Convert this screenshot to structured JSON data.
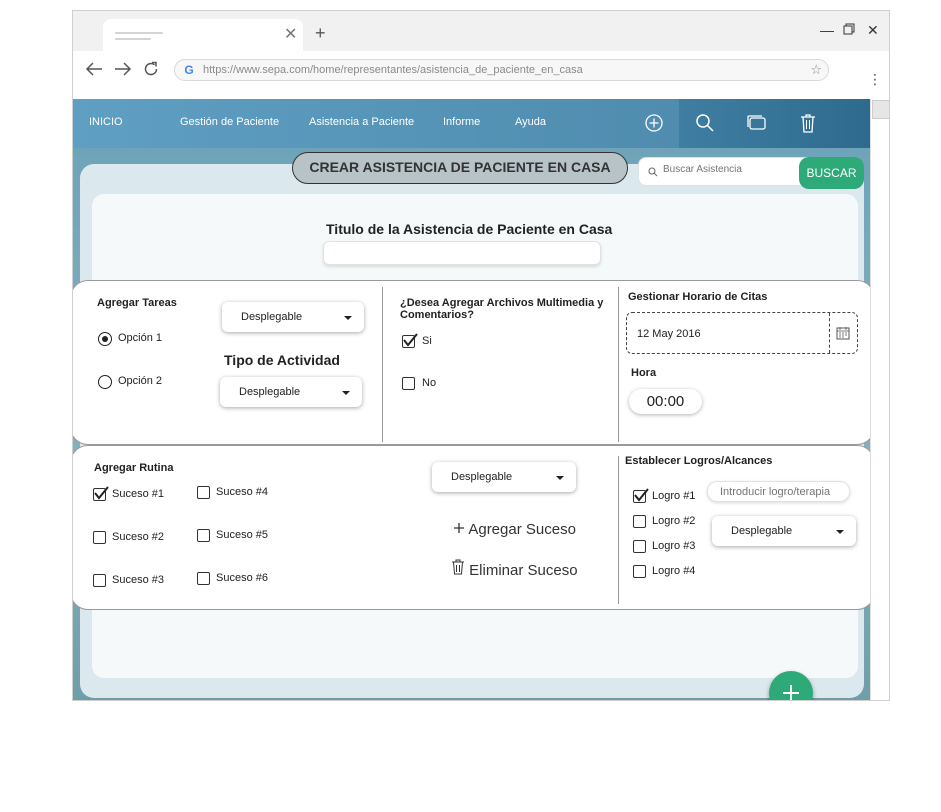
{
  "browser": {
    "url": "https://www.sepa.com/home/representantes/asistencia_de_paciente_en_casa",
    "tab_close": "✕",
    "new_tab": "+"
  },
  "nav": {
    "items": [
      "INICIO",
      "Gestión de Paciente",
      "Asistencia a Paciente",
      "Informe",
      "Ayuda"
    ],
    "tools": [
      "add-circle-icon",
      "search-icon",
      "windows-icon",
      "trash-icon"
    ]
  },
  "header": {
    "title": "CREAR ASISTENCIA DE PACIENTE EN CASA",
    "search_placeholder": "Buscar Asistencia",
    "search_button": "BUSCAR"
  },
  "titulo": {
    "label": "Titulo de la Asistencia de Paciente en Casa",
    "value": ""
  },
  "tareas": {
    "label": "Agregar Tareas",
    "options": [
      {
        "label": "Opción 1",
        "selected": true
      },
      {
        "label": "Opción 2",
        "selected": false
      }
    ],
    "dropdown": "Desplegable",
    "tipo_label": "Tipo de Actividad",
    "tipo_dropdown": "Desplegable"
  },
  "multimedia": {
    "label": "¿Desea Agregar Archivos Multimedia y Comentarios?",
    "options": [
      {
        "label": "Si",
        "checked": true
      },
      {
        "label": "No",
        "checked": false
      }
    ]
  },
  "horario": {
    "label": "Gestionar Horario de Citas",
    "date": "12 May 2016",
    "hora_label": "Hora",
    "hora": "00:00"
  },
  "rutina": {
    "label": "Agregar Rutina",
    "sucesos": [
      {
        "label": "Suceso #1",
        "checked": true
      },
      {
        "label": "Suceso #2",
        "checked": false
      },
      {
        "label": "Suceso #3",
        "checked": false
      },
      {
        "label": "Suceso #4",
        "checked": false
      },
      {
        "label": "Suceso #5",
        "checked": false
      },
      {
        "label": "Suceso #6",
        "checked": false
      }
    ],
    "dropdown": "Desplegable",
    "add_label": "Agregar Suceso",
    "delete_label": "Eliminar Suceso"
  },
  "logros": {
    "label": "Establecer Logros/Alcances",
    "items": [
      {
        "label": "Logro #1",
        "checked": true
      },
      {
        "label": "Logro #2",
        "checked": false
      },
      {
        "label": "Logro #3",
        "checked": false
      },
      {
        "label": "Logro #4",
        "checked": false
      }
    ],
    "input_placeholder": "Introducir logro/terapia",
    "dropdown": "Desplegable"
  },
  "colors": {
    "accent_green": "#2eaa79",
    "nav_blue": "#4f93b5"
  }
}
